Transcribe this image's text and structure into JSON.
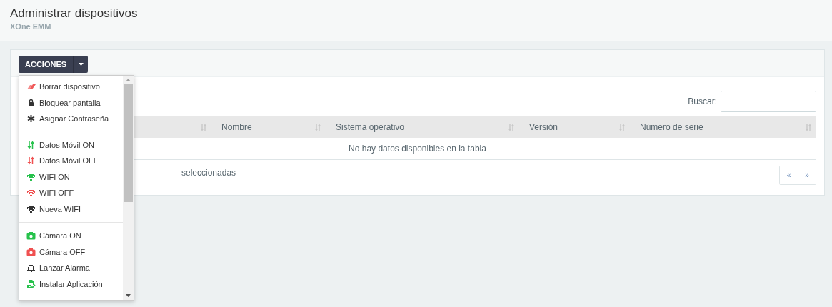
{
  "page_header": {
    "title": "Administrar dispositivos",
    "subtitle": "XOne EMM"
  },
  "actions_button": {
    "label": "ACCIONES"
  },
  "actions_menu": {
    "groups": [
      {
        "items": [
          {
            "label": "Borrar dispositivo",
            "kind": "eraser",
            "color": "#f05a5a"
          },
          {
            "label": "Bloquear pantalla",
            "kind": "lock",
            "color": "#333333"
          },
          {
            "label": "Asignar Contraseña",
            "kind": "asterisk",
            "color": "#333333"
          }
        ]
      },
      {
        "items": [
          {
            "label": "Datos Móvil ON",
            "kind": "updown",
            "color": "#27c24c"
          },
          {
            "label": "Datos Móvil OFF",
            "kind": "updown",
            "color": "#f05050"
          },
          {
            "label": "WIFI ON",
            "kind": "wifi",
            "color": "#27c24c"
          },
          {
            "label": "WIFI OFF",
            "kind": "wifi",
            "color": "#f05050"
          },
          {
            "label": "Nueva WIFI",
            "kind": "wifi",
            "color": "#333333"
          }
        ]
      },
      {
        "items": [
          {
            "label": "Cámara ON",
            "kind": "camera",
            "color": "#27c24c"
          },
          {
            "label": "Cámara OFF",
            "kind": "camera",
            "color": "#f05050"
          },
          {
            "label": "Lanzar Alarma",
            "kind": "bell",
            "color": "#333333"
          },
          {
            "label": "Instalar Aplicación",
            "kind": "install",
            "color": "#27c24c"
          }
        ]
      }
    ]
  },
  "search": {
    "label": "Buscar:"
  },
  "table": {
    "columns": [
      "",
      "Nombre",
      "Sistema operativo",
      "Versión",
      "Número de serie"
    ],
    "empty_message": "No hay datos disponibles en la tabla"
  },
  "selection_info": "seleccionadas",
  "pagination": {
    "previous": "«",
    "next": "»"
  }
}
